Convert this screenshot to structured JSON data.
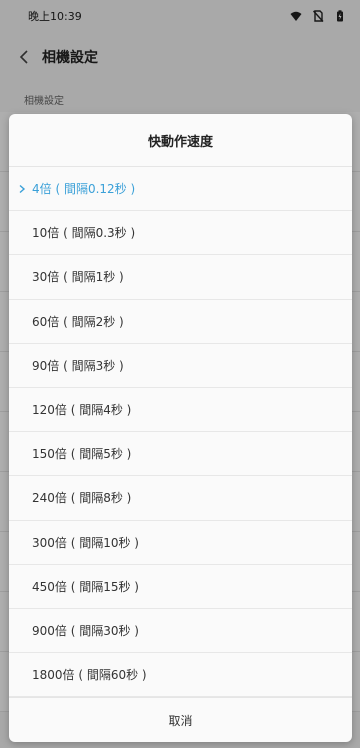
{
  "status_bar": {
    "time": "晚上10:39"
  },
  "app_bar": {
    "title": "相機設定"
  },
  "background": {
    "section_label": "相機設定"
  },
  "dialog": {
    "title": "快動作速度",
    "options": [
      {
        "label": "4倍 ( 間隔0.12秒 )",
        "selected": true
      },
      {
        "label": "10倍 ( 間隔0.3秒 )",
        "selected": false
      },
      {
        "label": "30倍 ( 間隔1秒 )",
        "selected": false
      },
      {
        "label": "60倍 ( 間隔2秒 )",
        "selected": false
      },
      {
        "label": "90倍 ( 間隔3秒 )",
        "selected": false
      },
      {
        "label": "120倍 ( 間隔4秒 )",
        "selected": false
      },
      {
        "label": "150倍 ( 間隔5秒 )",
        "selected": false
      },
      {
        "label": "240倍 ( 間隔8秒 )",
        "selected": false
      },
      {
        "label": "300倍 ( 間隔10秒 )",
        "selected": false
      },
      {
        "label": "450倍 ( 間隔15秒 )",
        "selected": false
      },
      {
        "label": "900倍 ( 間隔30秒 )",
        "selected": false
      },
      {
        "label": "1800倍 ( 間隔60秒 )",
        "selected": false
      }
    ],
    "cancel_label": "取消"
  },
  "colors": {
    "accent": "#3aa0d8"
  }
}
